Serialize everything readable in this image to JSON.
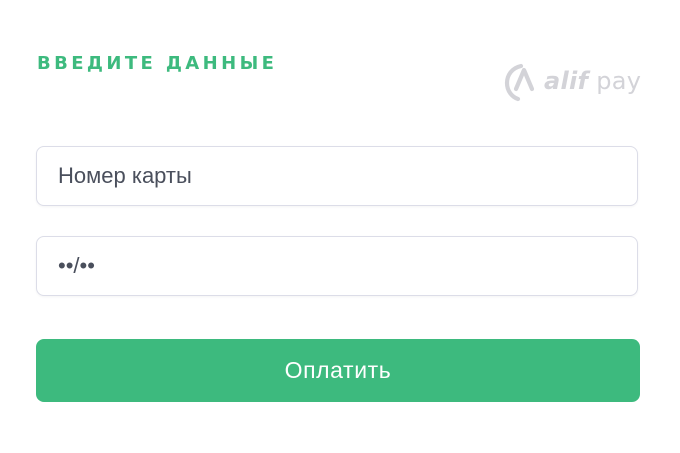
{
  "header": {
    "title": "ВВЕДИТЕ ДАННЫЕ"
  },
  "logo": {
    "brand": "alif",
    "product": "pay",
    "icon": "alif-logo-icon",
    "color": "#d3d3d8"
  },
  "form": {
    "card_number": {
      "value": "",
      "placeholder": "Номер карты"
    },
    "expiry": {
      "value": "",
      "placeholder": "••/••"
    },
    "submit_label": "Оплатить"
  },
  "colors": {
    "accent": "#3dba7e",
    "field_border": "#dcdde8",
    "placeholder_text": "#4a4f5c"
  }
}
